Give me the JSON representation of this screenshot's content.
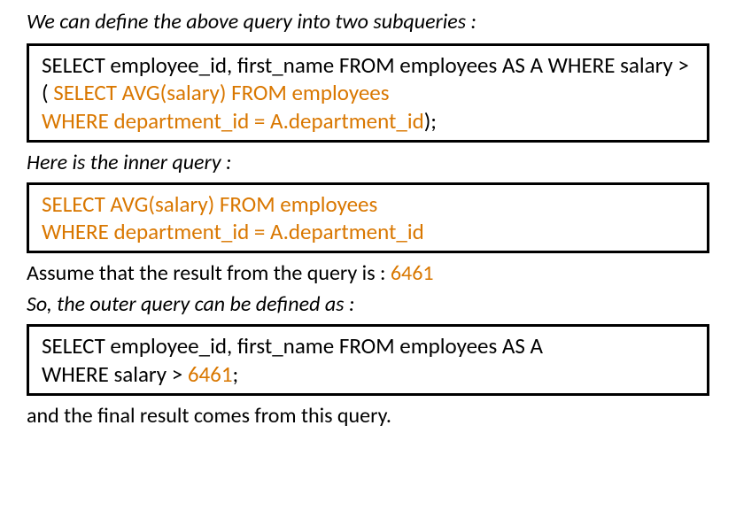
{
  "intro1": "We can define the above query into two subqueries :",
  "outer_full": {
    "l1": "SELECT employee_id, first_name",
    "l2": "FROM employees AS A",
    "l3": "WHERE salary >",
    "l4_open": "( ",
    "l4_hl": "SELECT AVG(salary) FROM employees",
    "l5_hl": "WHERE department_id = A.department_id",
    "l5_close": ");"
  },
  "intro2": "Here is the inner query :",
  "inner": {
    "l1": "SELECT AVG(salary) FROM employees",
    "l2": "WHERE department_id = A.department_id"
  },
  "assume_prefix": "Assume that the result from the query is : ",
  "assume_value": "6461",
  "intro3": "So, the outer query can be defined as :",
  "outer_final": {
    "l1": "SELECT employee_id, first_name",
    "l2": "FROM employees AS A",
    "l3_pre": "WHERE salary > ",
    "l3_val": "6461",
    "l3_post": ";"
  },
  "conclusion": "and the final result comes from this query."
}
